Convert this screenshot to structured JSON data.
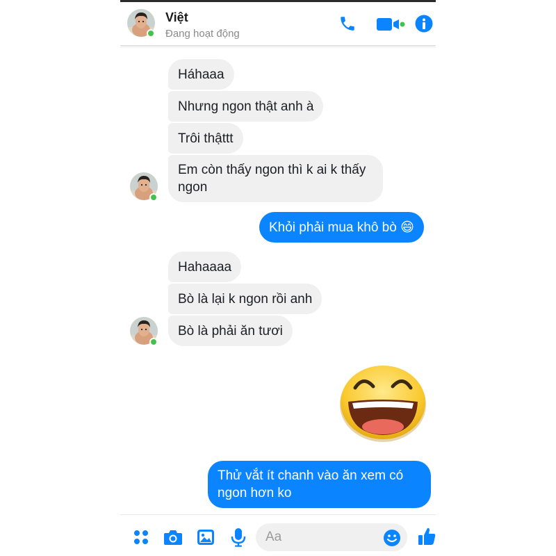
{
  "contact": {
    "name": "Việt",
    "status": "Đang hoạt động"
  },
  "header_icons": [
    "phone-icon",
    "video-camera-icon",
    "info-icon"
  ],
  "messages": [
    {
      "side": "in",
      "text": "Háhaaa"
    },
    {
      "side": "in",
      "text": "Nhưng ngon thật anh à"
    },
    {
      "side": "in",
      "text": "Trôi thậttt"
    },
    {
      "side": "in",
      "text": "Em còn thấy ngon thì k ai k thấy ngon"
    },
    {
      "side": "out",
      "text": "Khỏi phải mua khô bò 😄"
    },
    {
      "side": "in",
      "text": "Hahaaaa"
    },
    {
      "side": "in",
      "text": "Bò là lại k ngon rồi anh"
    },
    {
      "side": "in",
      "text": "Bò là phải ăn tươi"
    },
    {
      "side": "out",
      "sticker": "laughing-face-sticker"
    },
    {
      "side": "out",
      "text": "Thử vắt ít chanh vào ăn xem có ngon hơn ko"
    }
  ],
  "composer": {
    "placeholder": "Aa",
    "icons": [
      "apps-grid-icon",
      "camera-icon",
      "gallery-icon",
      "microphone-icon",
      "emoji-icon",
      "like-icon"
    ]
  },
  "colors": {
    "accent": "#0b84ff",
    "incoming_bubble": "#f1f0f0",
    "online": "#44c14e"
  }
}
